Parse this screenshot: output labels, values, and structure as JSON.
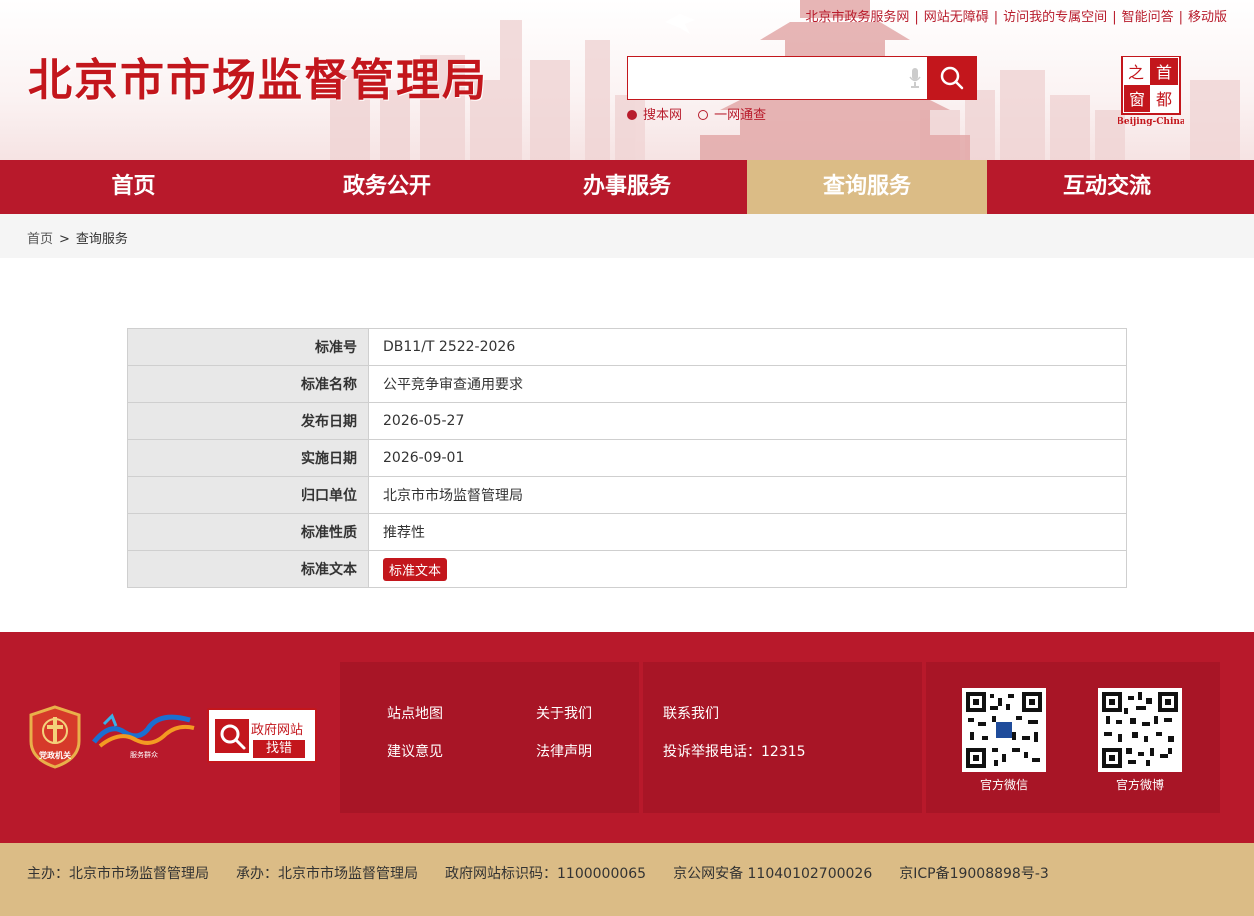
{
  "header": {
    "site_title": "北京市市场监督管理局",
    "top_links": [
      "北京市政务服务网",
      "网站无障碍",
      "访问我的专属空间",
      "智能问答",
      "移动版"
    ],
    "search": {
      "placeholder": "",
      "options": [
        {
          "label": "搜本网",
          "selected": true
        },
        {
          "label": "一网通查",
          "selected": false
        }
      ]
    },
    "capital_logo": {
      "chars": [
        "首",
        "都",
        "之",
        "窗"
      ],
      "subtitle": "Beijing-China"
    }
  },
  "nav": {
    "items": [
      {
        "label": "首页",
        "active": false
      },
      {
        "label": "政务公开",
        "active": false
      },
      {
        "label": "办事服务",
        "active": false
      },
      {
        "label": "查询服务",
        "active": true
      },
      {
        "label": "互动交流",
        "active": false
      }
    ]
  },
  "breadcrumb": {
    "home": "首页",
    "separator": ">",
    "current": "查询服务"
  },
  "detail": {
    "rows": [
      {
        "key": "标准号",
        "value": "DB11/T 2522-2026"
      },
      {
        "key": "标准名称",
        "value": "公平竞争审查通用要求"
      },
      {
        "key": "发布日期",
        "value": "2026-05-27"
      },
      {
        "key": "实施日期",
        "value": "2026-09-01"
      },
      {
        "key": "归口单位",
        "value": "北京市市场监督管理局"
      },
      {
        "key": "标准性质",
        "value": "推荐性"
      },
      {
        "key": "标准文本",
        "value": "标准文本"
      }
    ]
  },
  "footer": {
    "party_label": "党政机关",
    "brand2_sub": "服务群众",
    "find_bug": {
      "line1": "政府网站",
      "line2": "找错"
    },
    "links": {
      "site_map": "站点地图",
      "about": "关于我们",
      "suggestion": "建议意见",
      "legal": "法律声明",
      "contact": "联系我们",
      "hotline": "投诉举报电话：12315"
    },
    "qr": [
      {
        "caption": "官方微信"
      },
      {
        "caption": "官方微博"
      }
    ]
  },
  "bottom": {
    "host": "主办：北京市市场监督管理局",
    "organizer": "承办：北京市市场监督管理局",
    "site_code": "政府网站标识码：1100000065",
    "police": "京公网安备 11040102700026",
    "icp": "京ICP备19008898号-3"
  },
  "colors": {
    "brand_red": "#b8192b",
    "accent_gold": "#dbbc86",
    "label_bg": "#e8e8e8"
  }
}
